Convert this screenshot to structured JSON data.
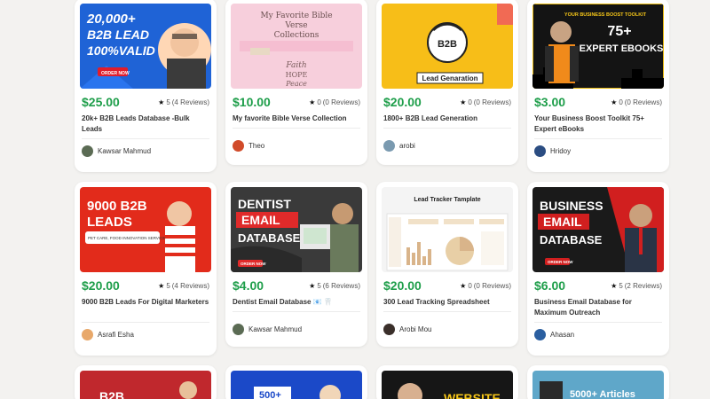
{
  "products": [
    {
      "price": "$25.00",
      "rating": "5",
      "reviews": "(4 Reviews)",
      "title": "20k+ B2B Leads Database -Bulk Leads",
      "author": "Kawsar Mahmud",
      "thumb_text": [
        "20,000+",
        "B2B LEAD",
        "100%VALID",
        "ORDER NOW"
      ],
      "colors": {
        "bg": "#1f63d6"
      }
    },
    {
      "price": "$10.00",
      "rating": "0",
      "reviews": "(0 Reviews)",
      "title": "My favorite Bible Verse Collection",
      "author": "Theo",
      "thumb_text": [
        "My Favorite Bible",
        "Verse",
        "Collections",
        "Faith",
        "HOPE",
        "Peace"
      ],
      "colors": {
        "bg": "#f7cfdc"
      }
    },
    {
      "price": "$20.00",
      "rating": "0",
      "reviews": "(0 Reviews)",
      "title": "1800+ B2B Lead Generation",
      "author": "arobi",
      "thumb_text": [
        "B2B",
        "Lead Genaration"
      ],
      "colors": {
        "bg": "#f7be18"
      }
    },
    {
      "price": "$3.00",
      "rating": "0",
      "reviews": "(0 Reviews)",
      "title": "Your Business Boost Toolkit 75+ Expert eBooks",
      "author": "Hridoy",
      "thumb_text": [
        "YOUR BUSINESS BOOST TOOLKIT",
        "75+",
        "EXPERT EBOOKS"
      ],
      "colors": {
        "bg": "#141414"
      }
    },
    {
      "price": "$20.00",
      "rating": "5",
      "reviews": "(4 Reviews)",
      "title": "9000 B2B Leads For Digital Marketers",
      "author": "Asrafi Esha",
      "thumb_text": [
        "9000 B2B",
        "LEADS",
        "PET CARE, FOOD INNOVATION SERVICE"
      ],
      "colors": {
        "bg": "#e22b1b"
      }
    },
    {
      "price": "$4.00",
      "rating": "5",
      "reviews": "(6 Reviews)",
      "title": "Dentist Email Database 📧 🦷",
      "author": "Kawsar Mahmud",
      "thumb_text": [
        "DENTIST",
        "EMAIL",
        "DATABASE",
        "ORDER NOW"
      ],
      "colors": {
        "bg": "#3a3a3a"
      }
    },
    {
      "price": "$20.00",
      "rating": "0",
      "reviews": "(0 Reviews)",
      "title": "300 Lead Tracking Spreadsheet",
      "author": "Arobi Mou",
      "thumb_text": [
        "Lead Tracker Tamplate"
      ],
      "colors": {
        "bg": "#f4f4f4"
      }
    },
    {
      "price": "$6.00",
      "rating": "5",
      "reviews": "(2 Reviews)",
      "title": "Business Email Database for Maximum Outreach",
      "author": "Ahasan",
      "thumb_text": [
        "BUSINESS",
        "EMAIL",
        "DATABASE",
        "ORDER NOW"
      ],
      "colors": {
        "bg": "#1a1a1a"
      }
    }
  ],
  "partial_row": [
    {
      "thumb_text": "B2B"
    },
    {
      "thumb_text": "500+"
    },
    {
      "thumb_text": "WEBSITE"
    },
    {
      "thumb_text": "5000+ Articles"
    }
  ]
}
